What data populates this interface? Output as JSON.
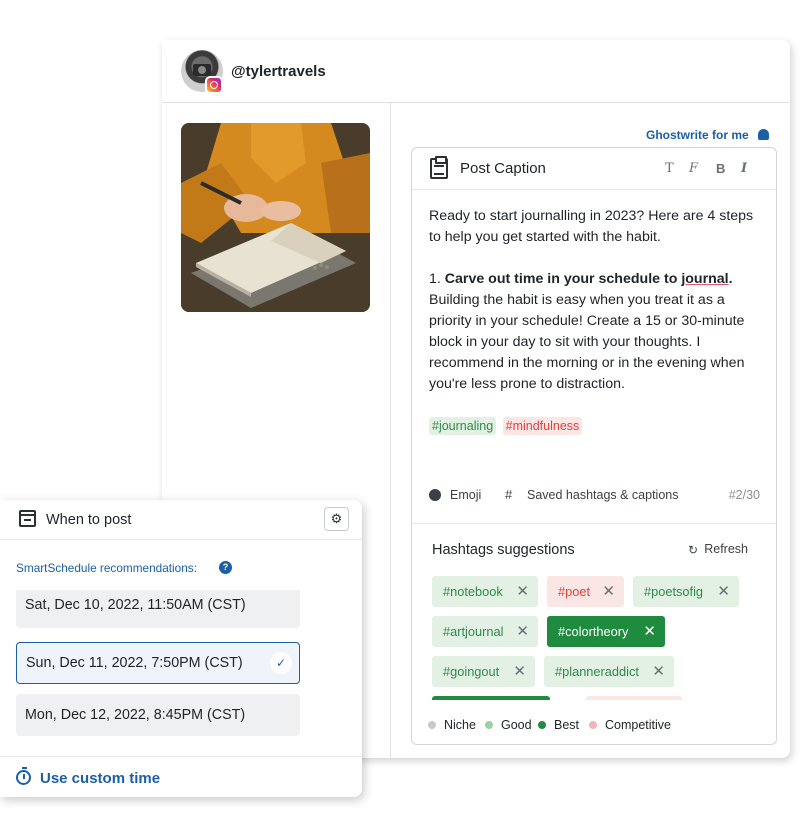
{
  "profile": {
    "handle": "@tylertravels",
    "platform_icon": "instagram-icon"
  },
  "ghostwrite": {
    "label": "Ghostwrite for me",
    "icon": "ghost-icon"
  },
  "caption": {
    "title": "Post Caption",
    "format_buttons": [
      "T",
      "F",
      "B",
      "I"
    ],
    "paragraph1": "Ready to start journalling in 2023? Here are 4 steps to help you get started with the habit.",
    "p2_number": "1.",
    "p2_bold_a": "Carve out time in your schedule to",
    "p2_bold_underlined": "journal",
    "p2_bold_end": ".",
    "p2_rest": "Building the habit is easy when you treat it as a priority in your schedule! Create a 15 or 30-minute block in your day to sit with your thoughts. I recommend in the morning or in the evening when you're less prone to distraction.",
    "inline_hashtags": [
      {
        "text": "#journaling",
        "level": "good"
      },
      {
        "text": "#mindfulness",
        "level": "competitive"
      }
    ],
    "footer": {
      "emoji_label": "Emoji",
      "saved_label": "Saved hashtags & captions",
      "counter": "#2/30"
    }
  },
  "suggestions": {
    "title": "Hashtags suggestions",
    "refresh_label": "Refresh",
    "chips": [
      {
        "text": "#notebook",
        "level": "good"
      },
      {
        "text": "#poet",
        "level": "competitive"
      },
      {
        "text": "#poetsofig",
        "level": "good"
      },
      {
        "text": "#artjournal",
        "level": "good"
      },
      {
        "text": "#colortheory",
        "level": "best"
      },
      {
        "text": "#goingout",
        "level": "good"
      },
      {
        "text": "#planneraddict",
        "level": "good"
      }
    ],
    "legend": [
      {
        "label": "Niche",
        "color": "#c7c9cc"
      },
      {
        "label": "Good",
        "color": "#9ad1a6"
      },
      {
        "label": "Best",
        "color": "#1f8b3e"
      },
      {
        "label": "Competitive",
        "color": "#f2b4b4"
      }
    ]
  },
  "schedule": {
    "title": "When to post",
    "smart_label": "SmartSchedule recommendations:",
    "slots": [
      {
        "text": "Sat, Dec 10, 2022, 11:50AM (CST)",
        "selected": false
      },
      {
        "text": "Sun, Dec 11, 2022, 7:50PM (CST)",
        "selected": true
      },
      {
        "text": "Mon, Dec 12, 2022, 8:45PM (CST)",
        "selected": false
      }
    ],
    "custom_time_label": "Use custom time"
  },
  "colors": {
    "accent_blue": "#1b5fa6",
    "best_green": "#1f8b3e",
    "good_bg": "#e3f1e5",
    "competitive_bg": "#fbe6e6"
  }
}
